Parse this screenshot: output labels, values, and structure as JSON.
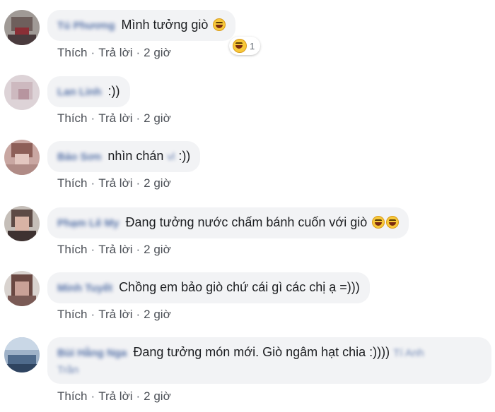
{
  "comments": [
    {
      "name": "Tú Phương",
      "text": "Mình tưởng giò",
      "emoji_count": 1,
      "reaction_count": "1",
      "actions": {
        "like": "Thích",
        "reply": "Trả lời",
        "time": "2 giờ"
      }
    },
    {
      "name": "Lan Linh",
      "text": ":))",
      "actions": {
        "like": "Thích",
        "reply": "Trả lời",
        "time": "2 giờ"
      }
    },
    {
      "name": "Bảo Sơn",
      "text_before": "nhìn chán",
      "blurred_word": "vl",
      "text_after": ":))",
      "actions": {
        "like": "Thích",
        "reply": "Trả lời",
        "time": "2 giờ"
      }
    },
    {
      "name": "Phạm Lê My",
      "text": "Đang tưởng nước chấm bánh cuốn với giò",
      "actions": {
        "like": "Thích",
        "reply": "Trả lời",
        "time": "2 giờ"
      }
    },
    {
      "name": "Minh Tuyết",
      "text": "Chồng em bảo giò chứ cái gì các chị ạ =)))",
      "actions": {
        "like": "Thích",
        "reply": "Trả lời",
        "time": "2 giờ"
      }
    },
    {
      "name": "Bùi Hằng Nga",
      "text": "Đang tưởng món mới. Giò ngâm hạt chia :))))",
      "tag_line1": "Tí Anh",
      "tag_line2": "Trần",
      "actions": {
        "like": "Thích",
        "reply": "Trả lời",
        "time": "2 giờ"
      }
    }
  ],
  "colors": {
    "bubble": "#f2f3f5",
    "name": "#385898",
    "text": "#1c1e21",
    "actions": "#4b4f56"
  }
}
